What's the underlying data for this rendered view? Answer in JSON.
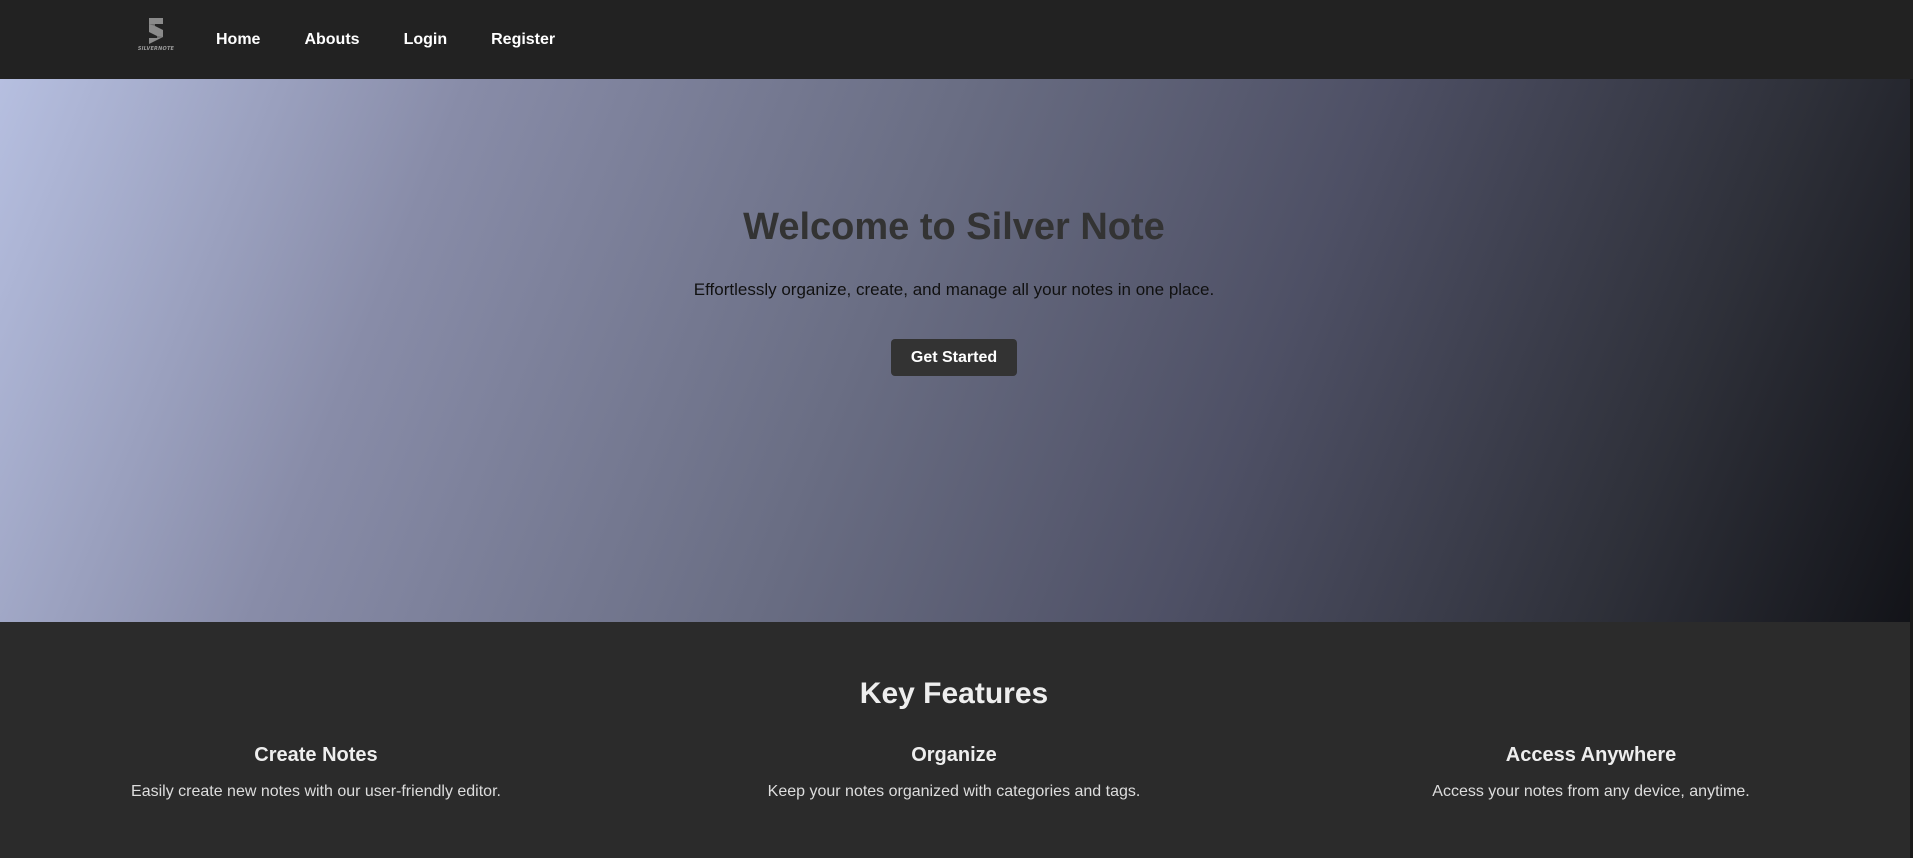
{
  "nav": {
    "logo_text": "SILVERNOTE",
    "links": [
      "Home",
      "Abouts",
      "Login",
      "Register"
    ]
  },
  "hero": {
    "title": "Welcome to Silver Note",
    "subtitle": "Effortlessly organize, create, and manage all your notes in one place.",
    "cta_label": "Get Started"
  },
  "features": {
    "title": "Key Features",
    "items": [
      {
        "title": "Create Notes",
        "description": "Easily create new notes with our user-friendly editor."
      },
      {
        "title": "Organize",
        "description": "Keep your notes organized with categories and tags."
      },
      {
        "title": "Access Anywhere",
        "description": "Access your notes from any device, anytime."
      }
    ]
  },
  "colors": {
    "nav_bg": "#222222",
    "page_bg": "#2b2b2b",
    "button_bg": "#333333"
  },
  "icons": {
    "logo": "silvernote-s-logo-icon"
  }
}
